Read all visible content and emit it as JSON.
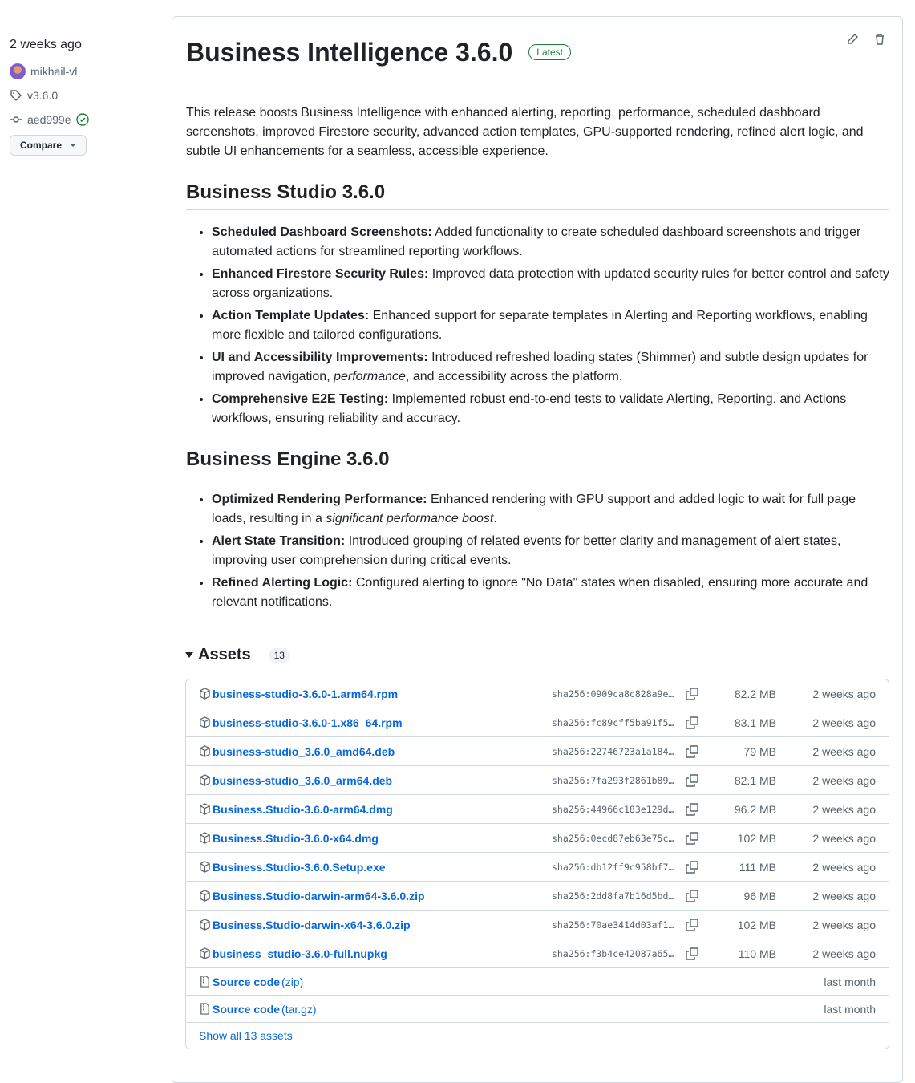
{
  "sidebar": {
    "date": "2 weeks ago",
    "author": "mikhail-vl",
    "tag": "v3.6.0",
    "commit": "aed999e",
    "compare": "Compare"
  },
  "release": {
    "title": "Business Intelligence 3.6.0",
    "badge": "Latest",
    "intro": "This release boosts Business Intelligence with enhanced alerting, reporting, performance, scheduled dashboard screenshots, improved Firestore security, advanced action templates, GPU-supported rendering, refined alert logic, and subtle UI enhancements for a seamless, accessible experience.",
    "sections": [
      {
        "title": "Business Studio 3.6.0",
        "items": [
          {
            "bold": "Scheduled Dashboard Screenshots:",
            "text": " Added functionality to create scheduled dashboard screenshots and trigger automated actions for streamlined reporting workflows."
          },
          {
            "bold": "Enhanced Firestore Security Rules:",
            "text": " Improved data protection with updated security rules for better control and safety across organizations."
          },
          {
            "bold": "Action Template Updates:",
            "text": " Enhanced support for separate templates in Alerting and Reporting workflows, enabling more flexible and tailored configurations."
          },
          {
            "bold": "UI and Accessibility Improvements:",
            "text": " Introduced refreshed loading states (Shimmer) and subtle design updates for improved navigation, ",
            "italic": "performance",
            "after": ", and accessibility across the platform."
          },
          {
            "bold": "Comprehensive E2E Testing:",
            "text": " Implemented robust end-to-end tests to validate Alerting, Reporting, and Actions workflows, ensuring reliability and accuracy."
          }
        ]
      },
      {
        "title": "Business Engine 3.6.0",
        "items": [
          {
            "bold": "Optimized Rendering Performance:",
            "text": " Enhanced rendering with GPU support and added logic to wait for full page loads, resulting in a ",
            "italic": "significant performance boost",
            "after": "."
          },
          {
            "bold": "Alert State Transition:",
            "text": " Introduced grouping of related events for better clarity and management of alert states, improving user comprehension during critical events."
          },
          {
            "bold": "Refined Alerting Logic:",
            "text": " Configured alerting to ignore \"No Data\" states when disabled, ensuring more accurate and relevant notifications."
          }
        ]
      }
    ]
  },
  "assets": {
    "title": "Assets",
    "count": "13",
    "show_all": "Show all 13 assets",
    "files": [
      {
        "name": "business-studio-3.6.0-1.arm64.rpm",
        "sha": "sha256:0909ca8c828a9e…",
        "size": "82.2 MB",
        "date": "2 weeks ago"
      },
      {
        "name": "business-studio-3.6.0-1.x86_64.rpm",
        "sha": "sha256:fc89cff5ba91f5…",
        "size": "83.1 MB",
        "date": "2 weeks ago"
      },
      {
        "name": "business-studio_3.6.0_amd64.deb",
        "sha": "sha256:22746723a1a184…",
        "size": "79 MB",
        "date": "2 weeks ago"
      },
      {
        "name": "business-studio_3.6.0_arm64.deb",
        "sha": "sha256:7fa293f2861b89…",
        "size": "82.1 MB",
        "date": "2 weeks ago"
      },
      {
        "name": "Business.Studio-3.6.0-arm64.dmg",
        "sha": "sha256:44966c183e129d…",
        "size": "96.2 MB",
        "date": "2 weeks ago"
      },
      {
        "name": "Business.Studio-3.6.0-x64.dmg",
        "sha": "sha256:0ecd87eb63e75c…",
        "size": "102 MB",
        "date": "2 weeks ago"
      },
      {
        "name": "Business.Studio-3.6.0.Setup.exe",
        "sha": "sha256:db12ff9c958bf7…",
        "size": "111 MB",
        "date": "2 weeks ago"
      },
      {
        "name": "Business.Studio-darwin-arm64-3.6.0.zip",
        "sha": "sha256:2dd8fa7b16d5bd…",
        "size": "96 MB",
        "date": "2 weeks ago"
      },
      {
        "name": "Business.Studio-darwin-x64-3.6.0.zip",
        "sha": "sha256:70ae3414d03af1…",
        "size": "102 MB",
        "date": "2 weeks ago"
      },
      {
        "name": "business_studio-3.6.0-full.nupkg",
        "sha": "sha256:f3b4ce42087a65…",
        "size": "110 MB",
        "date": "2 weeks ago"
      }
    ],
    "sources": [
      {
        "name": "Source code",
        "ext": " (zip)",
        "date": "last month"
      },
      {
        "name": "Source code",
        "ext": " (tar.gz)",
        "date": "last month"
      }
    ]
  }
}
